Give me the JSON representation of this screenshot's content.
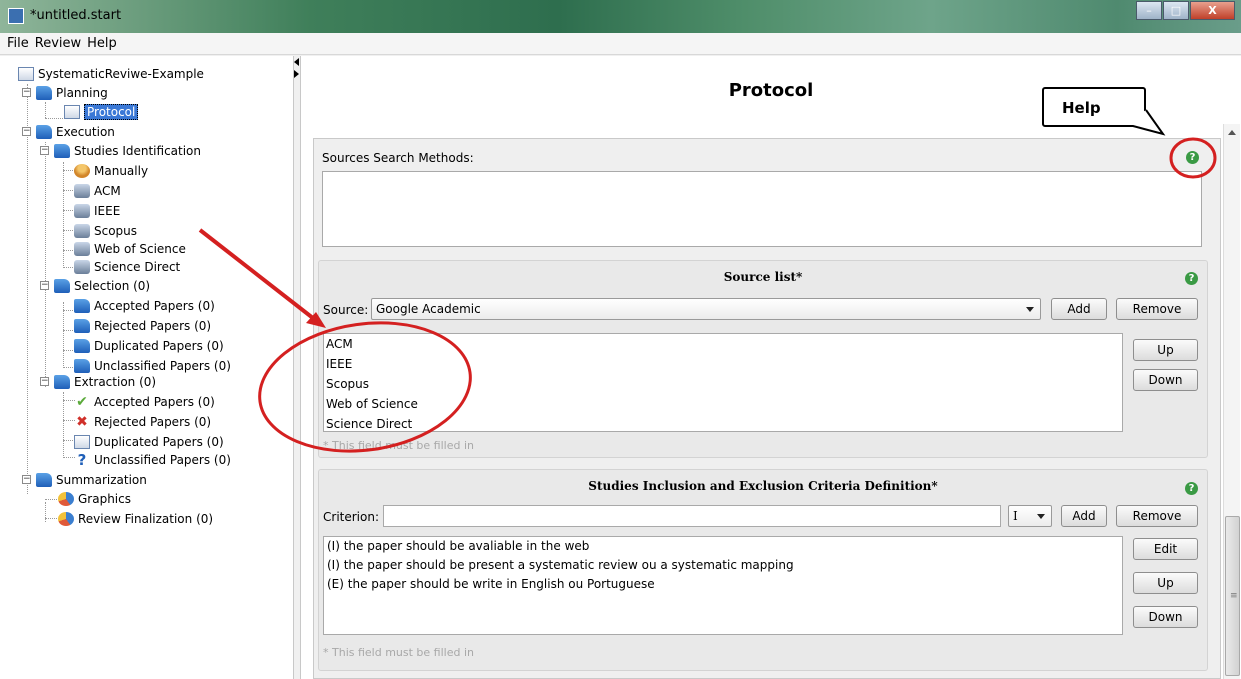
{
  "window": {
    "title": "*untitled.start",
    "buttons": {
      "minimize": "–",
      "maximize": "□",
      "close": "X"
    }
  },
  "menu": [
    "File",
    "Review",
    "Help"
  ],
  "tree": {
    "root": "SystematicReviwe-Example",
    "planning": {
      "label": "Planning",
      "protocol": "Protocol"
    },
    "execution": {
      "label": "Execution",
      "studies": {
        "label": "Studies Identification",
        "items": [
          "Manually",
          "ACM",
          "IEEE",
          "Scopus",
          "Web of Science",
          "Science Direct"
        ]
      },
      "selection": {
        "label": "Selection (0)",
        "items": [
          "Accepted Papers (0)",
          "Rejected Papers (0)",
          "Duplicated Papers (0)",
          "Unclassified Papers (0)"
        ]
      },
      "extraction": {
        "label": "Extraction (0)",
        "items": [
          "Accepted Papers (0)",
          "Rejected Papers (0)",
          "Duplicated Papers (0)",
          "Unclassified Papers (0)"
        ]
      }
    },
    "summarization": {
      "label": "Summarization",
      "items": [
        "Graphics",
        "Review Finalization (0)"
      ]
    }
  },
  "main": {
    "title": "Protocol",
    "sources_search": {
      "label": "Sources Search Methods:",
      "value": ""
    },
    "source_list": {
      "heading": "Source list*",
      "source_label": "Source:",
      "source_value": "Google Academic",
      "add": "Add",
      "remove": "Remove",
      "up": "Up",
      "down": "Down",
      "items": [
        "ACM",
        "IEEE",
        "Scopus",
        "Web of Science",
        "Science Direct"
      ],
      "hint": "* This field must be filled in"
    },
    "criteria": {
      "heading": "Studies Inclusion and Exclusion Criteria Definition*",
      "criterion_label": "Criterion:",
      "criterion_value": "",
      "type_value": "I",
      "add": "Add",
      "remove": "Remove",
      "edit": "Edit",
      "up": "Up",
      "down": "Down",
      "items": [
        "(I) the paper should be avaliable in the web",
        "(I) the paper should be present a systematic review ou a systematic mapping",
        "(E) the paper should be write in English ou Portuguese"
      ],
      "hint": "* This field must be filled in"
    }
  },
  "annotation": {
    "callout": "Help",
    "color": "#d42020"
  }
}
